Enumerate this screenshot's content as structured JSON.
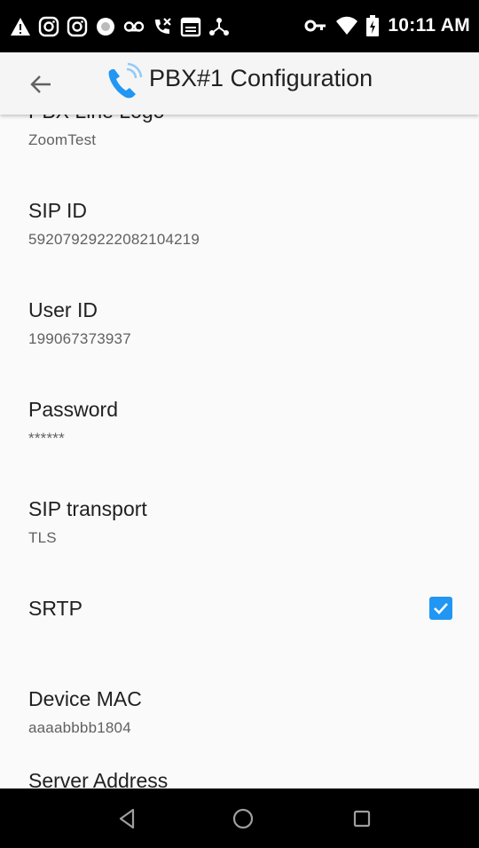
{
  "status_bar": {
    "time": "10:11 AM",
    "left_icons": [
      "warning-icon",
      "instagram-icon",
      "instagram-icon",
      "status-circle-icon",
      "voicemail-icon",
      "missed-call-icon",
      "calendar-icon",
      "network-icon"
    ],
    "right_icons": [
      "vpn-key-icon",
      "wifi-icon",
      "battery-charging-icon"
    ]
  },
  "app_bar": {
    "title": "PBX#1 Configuration",
    "accent_color": "#2196f3"
  },
  "preferences": [
    {
      "title": "PBX Line Logo",
      "summary": "ZoomTest"
    },
    {
      "title": "SIP ID",
      "summary": "59207929222082104219"
    },
    {
      "title": "User ID",
      "summary": "199067373937"
    },
    {
      "title": "Password",
      "summary": "******"
    },
    {
      "title": "SIP transport",
      "summary": "TLS"
    },
    {
      "title": "SRTP",
      "checked": true
    },
    {
      "title": "Device MAC",
      "summary": "aaaabbbb1804"
    },
    {
      "title": "Server Address"
    }
  ],
  "nav_bar": {
    "buttons": [
      "back-triangle-icon",
      "home-circle-icon",
      "recents-square-icon"
    ]
  }
}
